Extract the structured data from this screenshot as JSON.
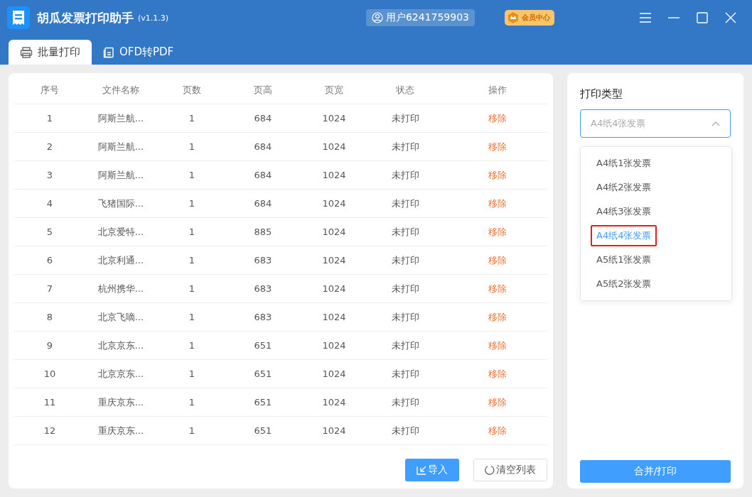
{
  "window": {
    "title": "胡瓜发票打印助手",
    "version": "(v1.1.3)",
    "user": "用户6241759903",
    "vip": "会员中心"
  },
  "tabs": [
    {
      "label": "批量打印",
      "selected": true,
      "kind": "printer"
    },
    {
      "label": "OFD转PDF",
      "selected": false,
      "kind": "document"
    }
  ],
  "table": {
    "columns": [
      "序号",
      "文件名称",
      "页数",
      "页高",
      "页宽",
      "状态",
      "操作"
    ],
    "rows": [
      [
        "1",
        "阿斯兰航...",
        "1",
        "684",
        "1024",
        "未打印",
        "移除"
      ],
      [
        "2",
        "阿斯兰航...",
        "1",
        "684",
        "1024",
        "未打印",
        "移除"
      ],
      [
        "3",
        "阿斯兰航...",
        "1",
        "684",
        "1024",
        "未打印",
        "移除"
      ],
      [
        "4",
        "飞猪国际...",
        "1",
        "684",
        "1024",
        "未打印",
        "移除"
      ],
      [
        "5",
        "北京爱特...",
        "1",
        "885",
        "1024",
        "未打印",
        "移除"
      ],
      [
        "6",
        "北京利通...",
        "1",
        "683",
        "1024",
        "未打印",
        "移除"
      ],
      [
        "7",
        "杭州携华...",
        "1",
        "683",
        "1024",
        "未打印",
        "移除"
      ],
      [
        "8",
        "北京飞嘀...",
        "1",
        "683",
        "1024",
        "未打印",
        "移除"
      ],
      [
        "9",
        "北京京东...",
        "1",
        "651",
        "1024",
        "未打印",
        "移除"
      ],
      [
        "10",
        "北京京东...",
        "1",
        "651",
        "1024",
        "未打印",
        "移除"
      ],
      [
        "11",
        "重庆京东...",
        "1",
        "651",
        "1024",
        "未打印",
        "移除"
      ],
      [
        "12",
        "重庆京东...",
        "1",
        "651",
        "1024",
        "未打印",
        "移除"
      ]
    ]
  },
  "buttons": {
    "import": "导入",
    "clear": "清空列表"
  },
  "print_type": {
    "label": "打印类型",
    "value": "A4纸4张发票",
    "expanded": true,
    "options": [
      {
        "label": "A4纸1张发票",
        "selected": false
      },
      {
        "label": "A4纸2张发票",
        "selected": false
      },
      {
        "label": "A4纸3张发票",
        "selected": false
      },
      {
        "label": "A4纸4张发票",
        "selected": true
      },
      {
        "label": "A5纸1张发票",
        "selected": false
      },
      {
        "label": "A5纸2张发票",
        "selected": false
      }
    ]
  },
  "merge_button": "合并/打印"
}
